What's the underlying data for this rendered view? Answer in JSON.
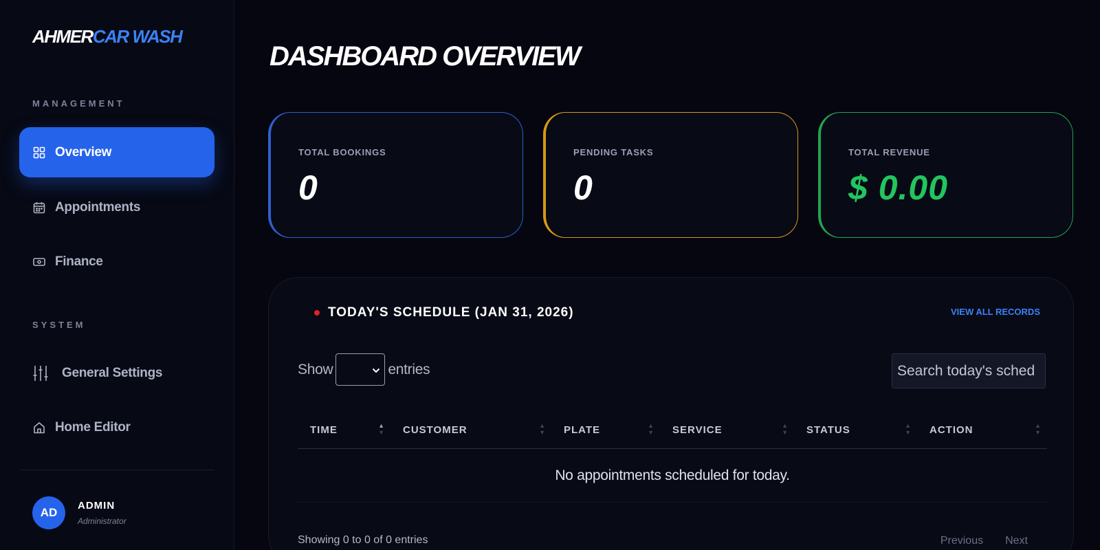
{
  "brand": {
    "part1": "AHMER",
    "part2": "CAR WASH"
  },
  "sidebar": {
    "management_label": "MANAGEMENT",
    "system_label": "SYSTEM",
    "items": [
      {
        "label": "Overview",
        "icon": "grid-icon",
        "active": true
      },
      {
        "label": "Appointments",
        "icon": "calendar-icon"
      },
      {
        "label": "Finance",
        "icon": "cash-icon"
      },
      {
        "label": "General Settings",
        "icon": "sliders-icon"
      },
      {
        "label": "Home Editor",
        "icon": "home-icon"
      }
    ],
    "user": {
      "initials": "AD",
      "name": "ADMIN",
      "role": "Administrator"
    }
  },
  "main": {
    "title": "DASHBOARD OVERVIEW",
    "stats": [
      {
        "label": "TOTAL BOOKINGS",
        "value": "0",
        "color": "#2f5fd0"
      },
      {
        "label": "PENDING TASKS",
        "value": "0",
        "color": "#d69a12"
      },
      {
        "label": "TOTAL REVENUE",
        "value": "$ 0.00",
        "color": "#20a550"
      }
    ],
    "schedule": {
      "title": "TODAY'S SCHEDULE (JAN 31, 2026)",
      "view_all": "VIEW ALL RECORDS",
      "show_label": "Show",
      "entries_label": "entries",
      "search_placeholder": "Search today's sched",
      "columns": [
        "TIME",
        "CUSTOMER",
        "PLATE",
        "SERVICE",
        "STATUS",
        "ACTION"
      ],
      "empty_message": "No appointments scheduled for today.",
      "info": "Showing 0 to 0 of 0 entries",
      "previous": "Previous",
      "next": "Next"
    }
  },
  "colors": {
    "accent": "#2563eb",
    "revenue": "#22c55e",
    "status_dot": "#dc2626"
  }
}
